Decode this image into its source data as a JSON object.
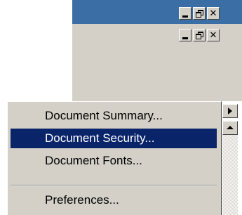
{
  "window": {
    "title_bar_color": "#3a6ea5",
    "title_buttons": [
      "minimize-icon",
      "restore-icon",
      "close-icon"
    ],
    "mdi_buttons": [
      "minimize-icon",
      "restore-icon",
      "close-icon"
    ],
    "close_glyph": "✕"
  },
  "menu": {
    "items": [
      {
        "label": "Document Summary..."
      },
      {
        "label": "Document Security...",
        "selected": true
      },
      {
        "label": "Document Fonts..."
      },
      {
        "label": "Preferences..."
      }
    ],
    "selection_color": "#0a246a"
  },
  "side": {
    "submenu_arrow": "triangle-right-icon",
    "scroll_up": "triangle-up-icon"
  }
}
